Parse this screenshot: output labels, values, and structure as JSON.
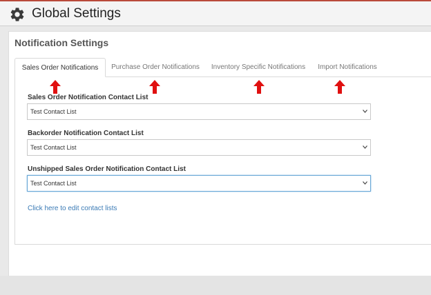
{
  "header": {
    "title": "Global Settings",
    "icon": "gear-icon"
  },
  "section": {
    "title": "Notification Settings"
  },
  "tabs": [
    {
      "label": "Sales Order Notifications",
      "active": true
    },
    {
      "label": "Purchase Order Notifications",
      "active": false
    },
    {
      "label": "Inventory Specific Notifications",
      "active": false
    },
    {
      "label": "Import Notifications",
      "active": false
    }
  ],
  "fields": [
    {
      "label": "Sales Order Notification Contact List",
      "value": "Test Contact List"
    },
    {
      "label": "Backorder Notification Contact List",
      "value": "Test Contact List"
    },
    {
      "label": "Unshipped Sales Order Notification Contact List",
      "value": "Test Contact List"
    }
  ],
  "link": {
    "label": "Click here to edit contact lists"
  },
  "colors": {
    "arrow": "#e01010",
    "link": "#3a7ab5",
    "accent_border": "#b94a3a"
  }
}
